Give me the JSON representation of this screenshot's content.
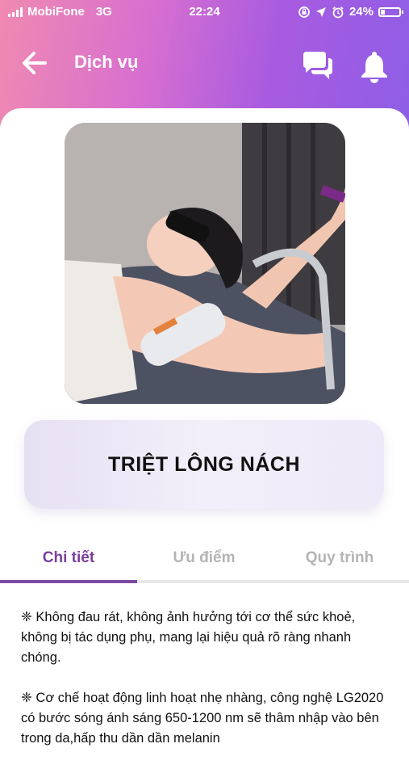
{
  "status_bar": {
    "carrier": "MobiFone",
    "network": "3G",
    "time": "22:24",
    "battery": "24%",
    "battery_level": 0.24,
    "icons": [
      "signal-icon",
      "screen-lock-icon",
      "location-icon",
      "alarm-icon",
      "battery-icon"
    ]
  },
  "header": {
    "title": "Dịch vụ",
    "icons": [
      "back-arrow-icon",
      "chat-icon",
      "bell-icon"
    ]
  },
  "service": {
    "name": "TRIỆT LÔNG NÁCH"
  },
  "tabs": [
    {
      "label": "Chi tiết",
      "active": true
    },
    {
      "label": "Ưu điểm",
      "active": false
    },
    {
      "label": "Quy trình",
      "active": false
    }
  ],
  "details": [
    "❈ Không đau rát, không ảnh hưởng tới cơ thể sức khoẻ, không bị tác dụng phụ, mang lại hiệu quả rõ ràng nhanh chóng.",
    "❈ Cơ chế hoạt động linh hoạt nhẹ nhàng, công nghệ LG2020 có bước sóng ánh sáng 650-1200 nm sẽ thâm nhập vào bên trong da,hấp thu dần dần melanin"
  ],
  "colors": {
    "header_gradient": [
      "#f08ab0",
      "#d86fd0",
      "#a85be0",
      "#8d5ee6"
    ],
    "active_tab": "#7a3f9d",
    "inactive_tab": "#b4b4b4"
  }
}
